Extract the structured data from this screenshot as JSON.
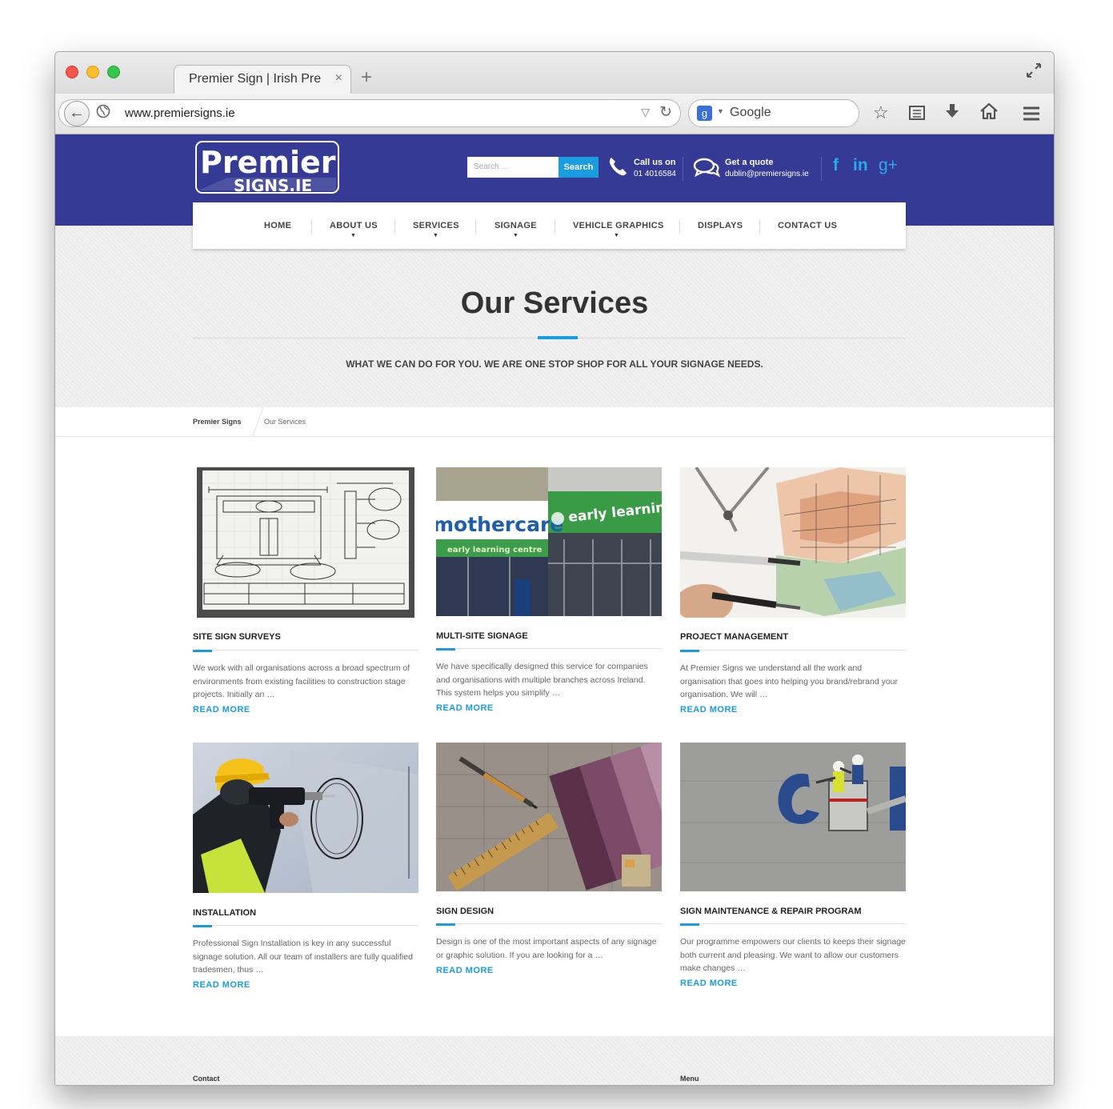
{
  "browser": {
    "tab_title": "Premier Sign  | Irish Pre",
    "tab_close": "×",
    "new_tab": "+",
    "url": "www.premiersigns.ie",
    "search_engine": "Google",
    "search_badge": "g"
  },
  "header": {
    "logo_line1": "Premier",
    "logo_line2": "SIGNS.IE",
    "search_placeholder": "Search ...",
    "search_button": "Search",
    "call_title": "Call us on",
    "call_number": "01 4016584",
    "quote_title": "Get a quote",
    "quote_email": "dublin@premiersigns.ie",
    "social": [
      "f",
      "in",
      "g+"
    ]
  },
  "nav": {
    "items": [
      {
        "label": "HOME",
        "has_dropdown": false
      },
      {
        "label": "ABOUT US",
        "has_dropdown": true
      },
      {
        "label": "SERVICES",
        "has_dropdown": true
      },
      {
        "label": "SIGNAGE",
        "has_dropdown": true
      },
      {
        "label": "VEHICLE GRAPHICS",
        "has_dropdown": true
      },
      {
        "label": "DISPLAYS",
        "has_dropdown": false
      },
      {
        "label": "CONTACT US",
        "has_dropdown": false
      }
    ],
    "caret": "▼"
  },
  "hero": {
    "title": "Our Services",
    "subtitle": "WHAT WE CAN DO FOR YOU. WE ARE ONE STOP SHOP FOR ALL YOUR SIGNAGE NEEDS."
  },
  "breadcrumb": {
    "home": "Premier Signs",
    "current": "Our Services"
  },
  "img_text": {
    "mothercare": "mothercare",
    "early_learning": "early learning c",
    "early_learning_centre": "early learning centre"
  },
  "services": [
    {
      "title": "SITE SIGN SURVEYS",
      "text": "We work with all organisations across a broad spectrum of environments from existing facilities to construction stage projects. Initially an …",
      "more": "READ MORE"
    },
    {
      "title": "MULTI-SITE SIGNAGE",
      "text": "We have specifically designed this service for companies and organisations with multiple branches across Ireland.  This system helps you simplify …",
      "more": "READ MORE"
    },
    {
      "title": "PROJECT MANAGEMENT",
      "text": "At Premier Signs we understand all the work and organisation that goes into helping you brand/rebrand your organisation. We will …",
      "more": "READ MORE"
    },
    {
      "title": "INSTALLATION",
      "text": "Professional Sign Installation is key in any successful signage solution.  All our team of installers are fully qualified tradesmen, thus …",
      "more": "READ MORE"
    },
    {
      "title": "SIGN DESIGN",
      "text": "Design is one of the most important aspects of any signage or graphic solution. If you are looking for a …",
      "more": "READ MORE"
    },
    {
      "title": "SIGN MAINTENANCE & REPAIR PROGRAM",
      "text": "Our programme empowers our clients to keeps their signage both current and pleasing. We want to allow our customers make changes …",
      "more": "READ MORE"
    }
  ],
  "footer": {
    "contact_heading": "Contact",
    "menu_heading": "Menu"
  },
  "colors": {
    "header_blue": "#353b94",
    "accent": "#1b9be0"
  }
}
